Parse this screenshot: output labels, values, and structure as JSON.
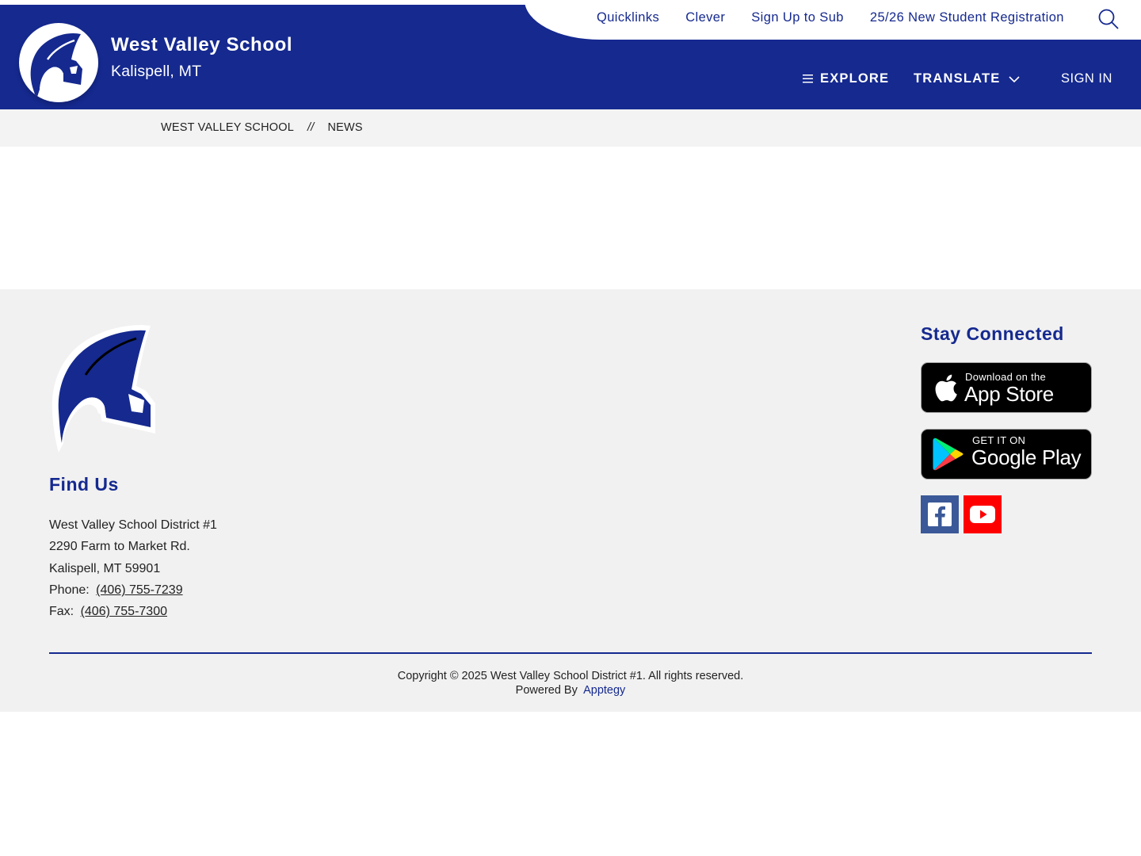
{
  "colors": {
    "brand_blue": "#15298f",
    "footer_bg": "#f1f1f1",
    "breadcrumb_bg": "#f3f3f3",
    "facebook_blue": "#3b5998",
    "youtube_red": "#ff0000"
  },
  "utility_nav": {
    "links": [
      "Quicklinks",
      "Clever",
      "Sign Up to Sub",
      "25/26 New Student Registration"
    ],
    "search_icon": "search-icon"
  },
  "header": {
    "school_name": "West Valley School",
    "location": "Kalispell, MT",
    "logo_icon": "spartan-helmet-logo"
  },
  "main_nav": {
    "explore_label": "EXPLORE",
    "explore_icon": "menu-icon",
    "translate_label": "TRANSLATE",
    "translate_icon": "chevron-down-icon",
    "signin_label": "SIGN IN"
  },
  "breadcrumb": {
    "items": [
      "WEST VALLEY SCHOOL",
      "NEWS"
    ],
    "separator": "//"
  },
  "footer": {
    "find_us_title": "Find Us",
    "address_line1": "West Valley School District #1",
    "address_line2": "2290 Farm to Market Rd.",
    "address_line3": "Kalispell, MT 59901",
    "phone_label": "Phone:",
    "phone": "(406) 755-7239",
    "fax_label": "Fax:",
    "fax": "(406) 755-7300",
    "stay_connected_title": "Stay Connected",
    "app_store_small": "Download on the",
    "app_store_big": "App Store",
    "google_small": "GET IT ON",
    "google_big": "Google Play",
    "social_icons": [
      "facebook-icon",
      "youtube-icon"
    ],
    "copyright": "Copyright © 2025 West Valley School District #1. All rights reserved.",
    "powered_by_label": "Powered By",
    "powered_by_link": "Apptegy"
  }
}
